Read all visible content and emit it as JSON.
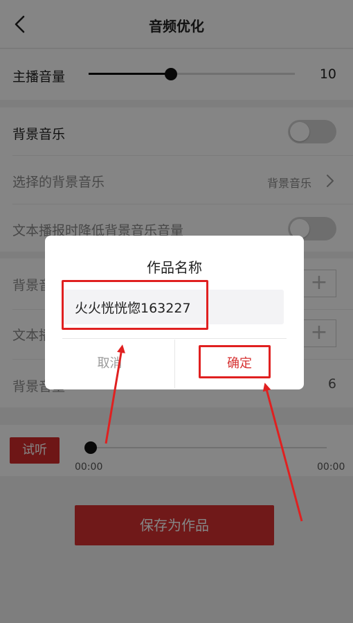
{
  "header": {
    "title": "音频优化",
    "back_icon": "chevron-left-icon"
  },
  "host_volume": {
    "label": "主播音量",
    "value": "10",
    "level": 0.4
  },
  "bg_music": {
    "label": "背景音乐",
    "toggle_on": false,
    "selected_label": "选择的背景音乐",
    "selected_value": "背景音乐",
    "lower_label": "文本播报时降低背景音乐音量",
    "lower_toggle_on": false
  },
  "section3": {
    "row1_label": "背景音",
    "row2_label": "文本播",
    "row3_label": "背景音量",
    "row3_value": "6",
    "plus_icon": "plus-icon"
  },
  "preview": {
    "button": "试听",
    "time_start": "00:00",
    "time_end": "00:00",
    "progress": 0
  },
  "save_button": "保存为作品",
  "dialog": {
    "title": "作品名称",
    "input_value": "火火恍恍惚163227",
    "cancel": "取消",
    "confirm": "确定"
  },
  "colors": {
    "accent": "#d63131",
    "highlight": "#e02020"
  }
}
